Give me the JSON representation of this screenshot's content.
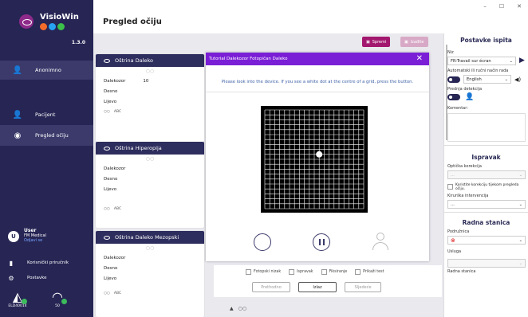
{
  "app": {
    "name": "VisioWin",
    "version": "1.3.0",
    "logo_dots": [
      "#f26b2a",
      "#28a3f2",
      "#3cc14a"
    ]
  },
  "window": {
    "min": "–",
    "max": "☐",
    "close": "✕"
  },
  "sidebar": {
    "user_item": "Anonimno",
    "items": [
      {
        "label": "Pacijent",
        "icon": "person-icon"
      },
      {
        "label": "Pregled očiju",
        "icon": "eye-icon"
      }
    ],
    "user": {
      "initial": "U",
      "name": "User",
      "org": "FM Medical",
      "logout": "Odjavi se"
    },
    "links": [
      {
        "label": "Korisnički priručnik",
        "icon": "book-icon"
      },
      {
        "label": "Postavke",
        "icon": "gear-icon"
      }
    ],
    "devices": [
      {
        "label": "ELD40014",
        "icon": "device-icon"
      },
      {
        "label": "50",
        "icon": "headset-icon"
      }
    ]
  },
  "header": {
    "title": "Pregled očiju"
  },
  "toolbar": {
    "save": "Spremi",
    "close": "Izađite"
  },
  "cards": [
    {
      "title": "Oštrina Daleko",
      "rows": [
        {
          "label": "Dalekozor",
          "value": "10"
        },
        {
          "label": "Desno",
          "value": ""
        },
        {
          "label": "Lijevo",
          "value": ""
        }
      ],
      "footer": "ABC"
    },
    {
      "title": "Oštrina Hiperopija",
      "rows": [
        {
          "label": "Dalekozor",
          "value": ""
        },
        {
          "label": "Desno",
          "value": ""
        },
        {
          "label": "Lijevo",
          "value": ""
        }
      ],
      "footer": "ABC"
    },
    {
      "title": "Oštrina Daleko Mezopski",
      "rows": [
        {
          "label": "Dalekozor",
          "value": ""
        },
        {
          "label": "Desno",
          "value": ""
        },
        {
          "label": "Lijevo",
          "value": ""
        }
      ],
      "footer": "ABC"
    }
  ],
  "modal": {
    "title": "Tutorial Dalekozor Fotopičan Daleko",
    "message": "Please look into the device. If you see a white dot at the centre of a grid, press the button."
  },
  "options": {
    "checkboxes": [
      "Fotopski nizak",
      "Ispravak",
      "Fiksiranje",
      "Prikaži test"
    ],
    "prev": "Prethodno",
    "exit": "Izlaz",
    "next": "Sljedeće"
  },
  "right_panel": {
    "title": "Postavke ispita",
    "niz_label": "Niz",
    "niz_value": "FR-Travail sur écran",
    "mode_label": "Automatski ili ručni način rada",
    "language": "English",
    "detection_label": "Prednja detekcija",
    "comment_label": "Komentar:",
    "correction_title": "Ispravak",
    "optical_label": "Optička korekcija",
    "optical_value": "...",
    "use_correction": "Koristite korekciju tijekom pregleda očiju.",
    "surgical_label": "Kirurška intervencija",
    "surgical_value": "...",
    "station_title": "Radna stanica",
    "branch_label": "Podružnica",
    "service_label": "Usluga",
    "workstation_label": "Radna stanica"
  }
}
